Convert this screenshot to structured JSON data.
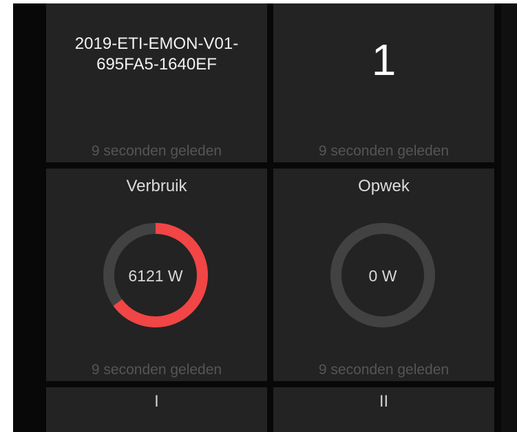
{
  "tiles": {
    "device": {
      "title": "2019-ETI-EMON-V01-\n695FA5-1640EF",
      "footer": "9 seconden geleden"
    },
    "count": {
      "value": "1",
      "footer": "9 seconden geleden"
    },
    "verbruik": {
      "title": "Verbruik",
      "value_label": "6121 W",
      "fill_fraction": 0.65,
      "footer": "9 seconden geleden"
    },
    "opwek": {
      "title": "Opwek",
      "value_label": "0 W",
      "fill_fraction": 0,
      "footer": "9 seconden geleden"
    },
    "phase1": {
      "title": "I"
    },
    "phase2": {
      "title": "II"
    }
  },
  "colors": {
    "gauge_fill": "#f24545",
    "gauge_track": "#424242",
    "tile_bg": "#232323"
  }
}
